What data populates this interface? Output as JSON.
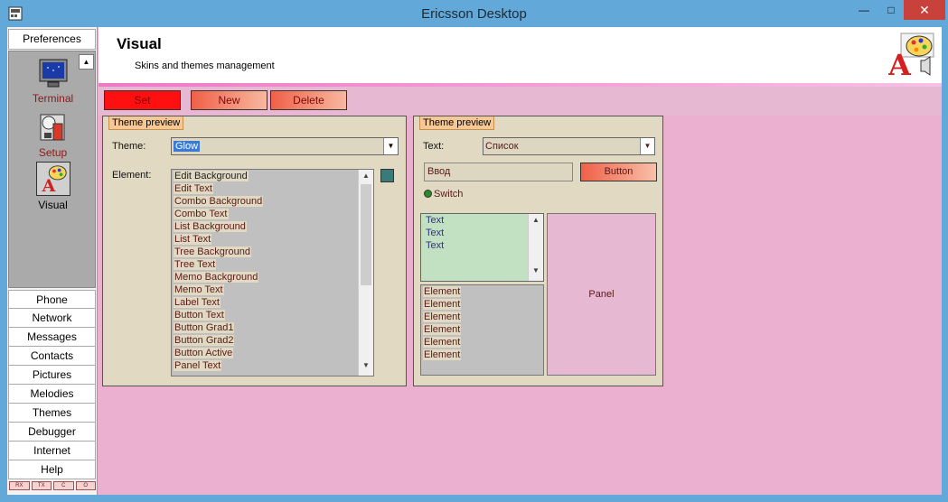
{
  "window": {
    "title": "Ericsson Desktop",
    "min": "—",
    "max": "□",
    "close": "✕"
  },
  "sidebar": {
    "header": "Preferences",
    "scroll_up": "▲",
    "prefs": [
      {
        "label": "Terminal",
        "icon": "terminal-icon"
      },
      {
        "label": "Setup",
        "icon": "setup-icon"
      },
      {
        "label": "Visual",
        "icon": "visual-icon"
      }
    ],
    "nav": [
      "Phone",
      "Network",
      "Messages",
      "Contacts",
      "Pictures",
      "Melodies",
      "Themes",
      "Debugger",
      "Internet",
      "Help"
    ],
    "status": [
      "RX",
      "TX",
      "C",
      "O"
    ]
  },
  "header": {
    "title": "Visual",
    "subtitle": "Skins and themes management"
  },
  "toolbar": {
    "set": "Set",
    "new": "New",
    "delete": "Delete"
  },
  "left_group": {
    "caption": "Theme preview",
    "theme_label": "Theme:",
    "theme_value": "Glow",
    "element_label": "Element:",
    "elements": [
      "Edit Background",
      "Edit Text",
      "Combo Background",
      "Combo Text",
      "List Background",
      "List Text",
      "Tree Background",
      "Tree Text",
      "Memo Background",
      "Memo Text",
      "Label Text",
      "Button Text",
      "Button Grad1",
      "Button Grad2",
      "Button Active",
      "Panel Text"
    ],
    "swatch_color": "#3a7a78"
  },
  "right_group": {
    "caption": "Theme preview",
    "text_label": "Text:",
    "text_combo_value": "Список",
    "edit_value": "Ввод",
    "button_label": "Button",
    "switch_label": "Switch",
    "memo_lines": [
      "Text",
      "Text",
      "Text"
    ],
    "list_items": [
      "Element",
      "Element",
      "Element",
      "Element",
      "Element",
      "Element"
    ],
    "panel_label": "Panel"
  },
  "colors": {
    "background": "#ebb0cf",
    "accent": "#ff1010",
    "group": "#e1d9c1"
  }
}
